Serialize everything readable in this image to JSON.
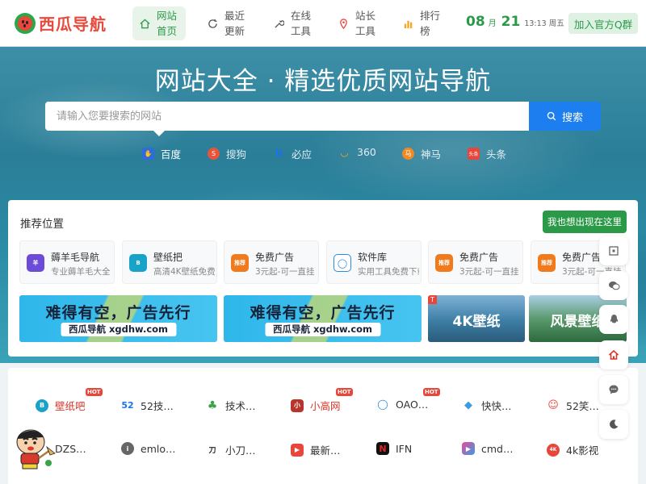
{
  "header": {
    "logo_text": "西瓜导航",
    "nav": [
      {
        "label": "网站首页",
        "icon": "home-icon",
        "active": true
      },
      {
        "label": "最近更新",
        "icon": "refresh-icon",
        "active": false
      },
      {
        "label": "在线工具",
        "icon": "wrench-icon",
        "active": false
      },
      {
        "label": "站长工具",
        "icon": "location-icon",
        "active": false
      },
      {
        "label": "排行榜",
        "icon": "bar-chart-icon",
        "active": false
      }
    ],
    "date": {
      "month": "08",
      "month_unit": "月",
      "day": "21",
      "time": "13:13",
      "weekday": "周五"
    },
    "join_button": "加入官方Q群"
  },
  "hero": {
    "title": "网站大全 · 精选优质网站导航",
    "search_placeholder": "请输入您要搜索的网站",
    "search_button": "搜索",
    "engines": [
      {
        "label": "百度",
        "icon": "baidu-icon",
        "color": "#2f6bdf"
      },
      {
        "label": "搜狗",
        "icon": "sogou-icon",
        "color": "#e8543a"
      },
      {
        "label": "必应",
        "icon": "bing-icon",
        "color": "#1a73e8"
      },
      {
        "label": "360",
        "icon": "360-icon",
        "color": "#f5a623"
      },
      {
        "label": "神马",
        "icon": "shenma-icon",
        "color": "#f08a24"
      },
      {
        "label": "头条",
        "icon": "toutiao-icon",
        "color": "#e8463a"
      }
    ]
  },
  "recommend": {
    "title": "推荐位置",
    "button": "我也想出现在这里",
    "items": [
      {
        "name": "薅羊毛导航",
        "desc": "专业薅羊毛大全",
        "icon_text": "羊",
        "color": "#6c4bd8"
      },
      {
        "name": "壁纸把",
        "desc": "高清4K壁纸免费下载",
        "icon_text": "B",
        "color": "#1aa3c8"
      },
      {
        "name": "免费广告",
        "desc": "3元起-可一直挂",
        "icon_text": "推荐",
        "color": "#f07a1c"
      },
      {
        "name": "软件库",
        "desc": "实用工具免费下载",
        "icon_text": "◯",
        "color": "#2a8ce0"
      },
      {
        "name": "免费广告",
        "desc": "3元起-可一直挂",
        "icon_text": "推荐",
        "color": "#f07a1c"
      },
      {
        "name": "免费广告",
        "desc": "3元起-可一直挂",
        "icon_text": "推荐",
        "color": "#f07a1c"
      }
    ],
    "banners": [
      {
        "type": "ad",
        "text": "难得有空，广告先行",
        "sub": "西瓜导航 xgdhw.com"
      },
      {
        "type": "ad",
        "text": "难得有空，广告先行",
        "sub": "西瓜导航 xgdhw.com"
      },
      {
        "type": "wallpaper",
        "text": "4K壁纸",
        "tag": "T"
      },
      {
        "type": "wallpaper",
        "text": "风景壁纸"
      }
    ]
  },
  "links": [
    {
      "label": "壁纸吧",
      "icon_text": "B",
      "color": "#1aa3c8",
      "red": true,
      "hot": true
    },
    {
      "label": "52技…",
      "icon_text": "52",
      "color": "#1a73e8",
      "red": false,
      "hot": false
    },
    {
      "label": "技术…",
      "icon_text": "♣",
      "color": "#3aa34a",
      "red": false,
      "hot": false
    },
    {
      "label": "小高网",
      "icon_text": "小",
      "color": "#b8352b",
      "red": true,
      "hot": true
    },
    {
      "label": "OAO…",
      "icon_text": "◯",
      "color": "#2a8ce0",
      "red": false,
      "hot": true
    },
    {
      "label": "快快…",
      "icon_text": "◆",
      "color": "#3b9de0",
      "red": false,
      "hot": false
    },
    {
      "label": "52笑…",
      "icon_text": "☺",
      "color": "#e8463a",
      "red": false,
      "hot": false
    },
    {
      "label": "DZS…",
      "icon_text": "D",
      "color": "#555555",
      "red": false,
      "hot": false
    },
    {
      "label": "emlo…",
      "icon_text": "i",
      "color": "#666666",
      "red": false,
      "hot": false
    },
    {
      "label": "小刀…",
      "icon_text": "刀",
      "color": "#222222",
      "red": false,
      "hot": false
    },
    {
      "label": "最新…",
      "icon_text": "▶",
      "color": "#e8463a",
      "red": false,
      "hot": false
    },
    {
      "label": "IFN",
      "icon_text": "N",
      "color": "#d8262b",
      "red": false,
      "hot": false
    },
    {
      "label": "cmd…",
      "icon_text": "▶",
      "color": "#e84a9b",
      "red": false,
      "hot": false
    },
    {
      "label": "4k影视",
      "icon_text": "4K",
      "color": "#e8463a",
      "red": false,
      "hot": false
    }
  ],
  "sidebar_buttons": [
    {
      "name": "qrcode-icon"
    },
    {
      "name": "wechat-icon"
    },
    {
      "name": "qq-icon"
    },
    {
      "name": "home-icon"
    },
    {
      "name": "chat-icon"
    },
    {
      "name": "moon-icon"
    }
  ],
  "hot_label": "HOT"
}
